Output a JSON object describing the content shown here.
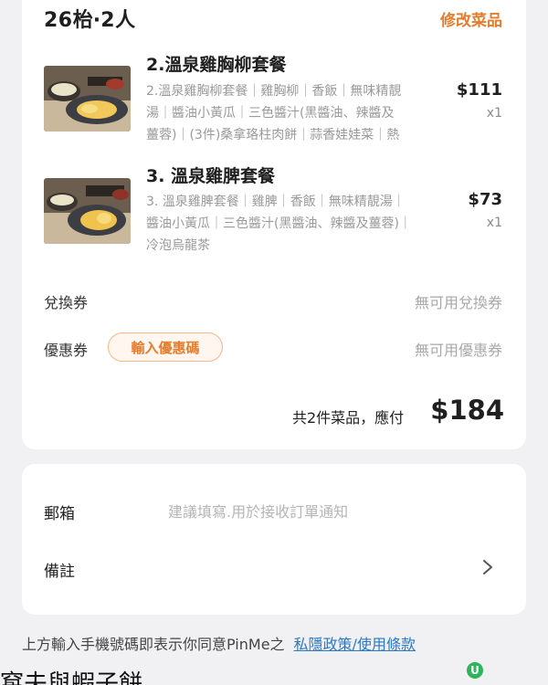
{
  "order": {
    "table_title": "26枱‧2人",
    "edit_label": "修改菜品",
    "items": [
      {
        "name": "2.溫泉雞胸柳套餐",
        "desc_lines": [
          "2.溫泉雞胸柳套餐｜雞胸柳｜香飯｜無味精靚",
          "湯｜醬油小黃瓜｜三色醬汁(黑醬油、辣醬及",
          "薑蓉)｜(3件)桑拿珞柱肉餅｜蒜香娃娃菜｜熱"
        ],
        "price": "$111",
        "qty": "x1",
        "image_icon": "rice-set-meal-photo"
      },
      {
        "name": "3. 溫泉雞脾套餐",
        "desc_lines": [
          "3. 溫泉雞脾套餐｜雞脾｜香飯｜無味精靚湯｜",
          "醬油小黃瓜｜三色醬汁(黑醬油、辣醬及薑蓉)｜",
          "冷泡烏龍茶"
        ],
        "price": "$73",
        "qty": "x1",
        "image_icon": "rice-set-meal-photo"
      }
    ],
    "voucher": {
      "label": "兌換券",
      "value": "無可用兌換券"
    },
    "coupon": {
      "label": "優惠券",
      "button_label": "輸入優惠碼",
      "value": "無可用優惠券"
    },
    "total": {
      "label": "共2件菜品，應付",
      "amount": "$184"
    }
  },
  "contact": {
    "email_label": "郵箱",
    "email_placeholder": "建議填寫.用於接收訂單通知",
    "email_value": "",
    "notes_label": "備註"
  },
  "footer": {
    "text": "上方輸入手機號碼即表示你同意PinMe之",
    "link": "私隱政策/使用條款"
  },
  "watermark": {
    "logo_letter": "U"
  },
  "caption": "窩夫與蝦子餅"
}
